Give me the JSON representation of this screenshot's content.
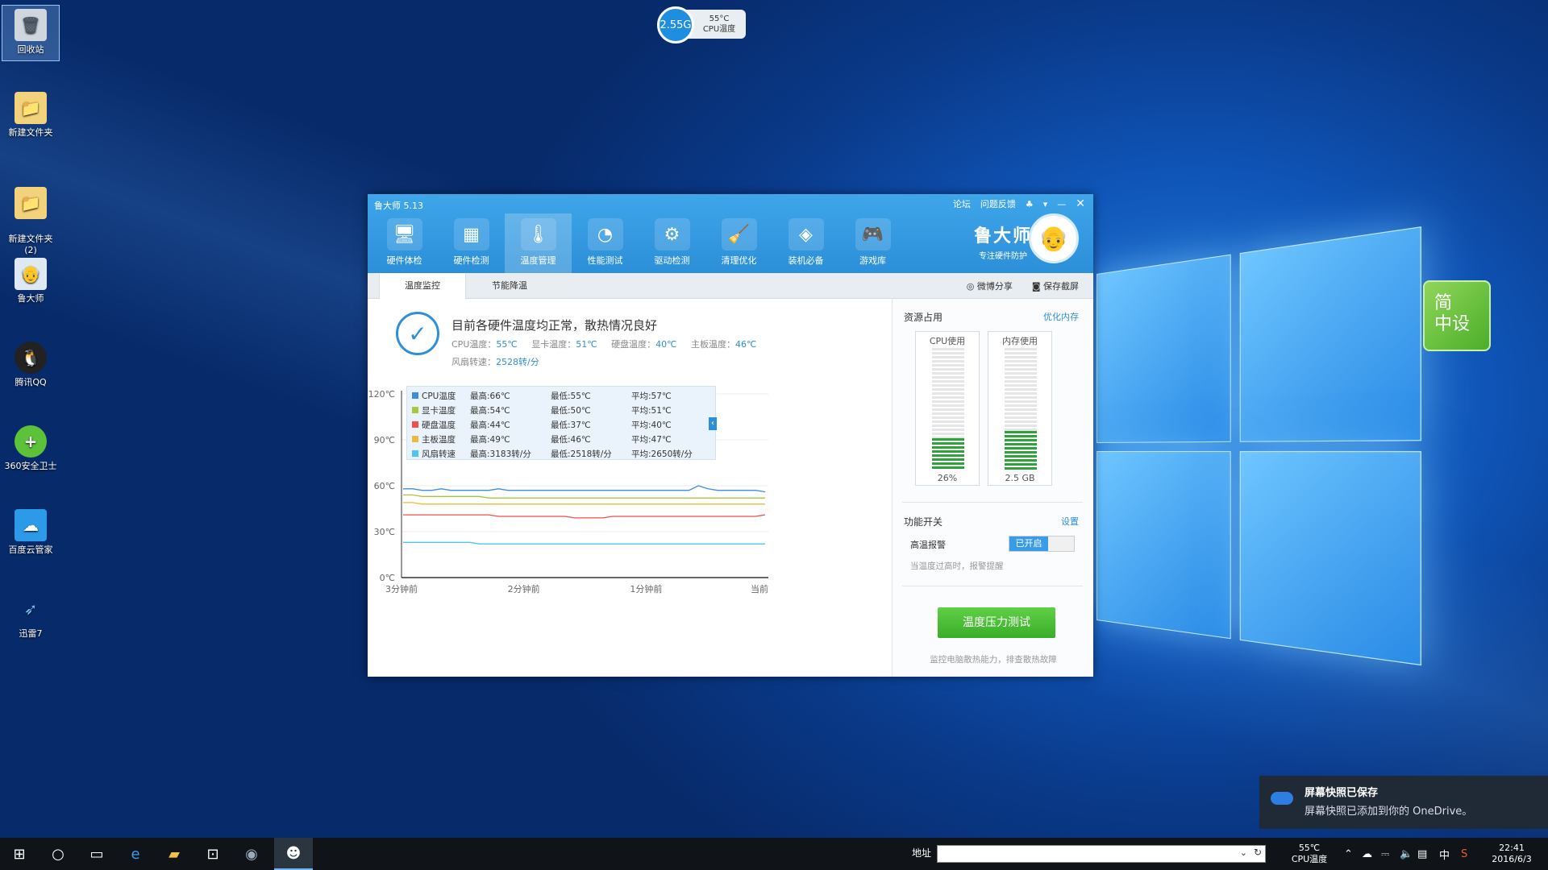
{
  "desktop": {
    "icons": [
      {
        "label": "回收站",
        "icon": "recycle-bin-icon"
      },
      {
        "label": "新建文件夹",
        "icon": "folder-icon"
      },
      {
        "label": "新建文件夹\n(2)",
        "icon": "folder-icon"
      },
      {
        "label": "鲁大师",
        "icon": "ludashi-icon"
      },
      {
        "label": "腾讯QQ",
        "icon": "qq-icon"
      },
      {
        "label": "360安全卫士",
        "icon": "360-icon"
      },
      {
        "label": "百度云管家",
        "icon": "baidu-cloud-icon"
      },
      {
        "label": "迅雷7",
        "icon": "xunlei-icon"
      }
    ]
  },
  "cpu_widget": {
    "memory": "2.55G",
    "temp": "55°C",
    "label": "CPU温度"
  },
  "green_widget": {
    "text1": "简",
    "text2": "中设"
  },
  "app": {
    "title": "鲁大师 5.13",
    "top_links": [
      "论坛",
      "问题反馈"
    ],
    "nav": [
      "硬件体检",
      "硬件检测",
      "温度管理",
      "性能测试",
      "驱动检测",
      "清理优化",
      "装机必备",
      "游戏库"
    ],
    "nav_active": 2,
    "brand": {
      "name": "鲁大师",
      "slogan": "专注硬件防护"
    },
    "tabs": [
      "温度监控",
      "节能降温"
    ],
    "tab_actions": {
      "share": "微博分享",
      "save": "保存截屏"
    },
    "status": "目前各硬件温度均正常，散热情况良好",
    "temps": {
      "cpu_label": "CPU温度：",
      "cpu": "55℃",
      "gpu_label": "显卡温度：",
      "gpu": "51℃",
      "disk_label": "硬盘温度：",
      "disk": "40℃",
      "board_label": "主板温度：",
      "board": "46℃"
    },
    "fan_label": "风扇转速：",
    "fan": "2528转/分",
    "legend": [
      {
        "name": "CPU温度",
        "max": "最高:66℃",
        "min": "最低:55℃",
        "avg": "平均:57℃",
        "color": "#3a8fe0"
      },
      {
        "name": "显卡温度",
        "max": "最高:54℃",
        "min": "最低:50℃",
        "avg": "平均:51℃",
        "color": "#a8c83a"
      },
      {
        "name": "硬盘温度",
        "max": "最高:44℃",
        "min": "最低:37℃",
        "avg": "平均:40℃",
        "color": "#f0504a"
      },
      {
        "name": "主板温度",
        "max": "最高:49℃",
        "min": "最低:46℃",
        "avg": "平均:47℃",
        "color": "#f0b83a"
      },
      {
        "name": "风扇转速",
        "max": "最高:3183转/分",
        "min": "最低:2518转/分",
        "avg": "平均:2650转/分",
        "color": "#4ac8f0"
      }
    ],
    "resources": {
      "title": "资源占用",
      "optimize": "优化内存",
      "cpu_label": "CPU使用",
      "cpu_value": "26%",
      "cpu_pct": 26,
      "mem_label": "内存使用",
      "mem_value": "2.5 GB",
      "mem_pct": 32
    },
    "functions": {
      "title": "功能开关",
      "settings": "设置",
      "alarm_label": "高温报警",
      "alarm_state": "已开启",
      "alarm_desc": "当温度过高时，报警提醒"
    },
    "stress_button": "温度压力测试",
    "stress_note": "监控电脑散热能力，排查散热故障"
  },
  "chart_data": {
    "type": "line",
    "y_ticks": [
      "120℃",
      "90℃",
      "60℃",
      "30℃",
      "0℃"
    ],
    "x_ticks": [
      "3分钟前",
      "2分钟前",
      "1分钟前",
      "当前"
    ],
    "ylim": [
      0,
      120
    ],
    "grid": true,
    "series": [
      {
        "name": "CPU温度",
        "color": "#3a8fe0",
        "values": [
          58,
          58,
          57,
          57,
          58,
          57,
          57,
          57,
          57,
          57,
          58,
          57,
          57,
          57,
          57,
          57,
          57,
          57,
          57,
          57,
          57,
          57,
          57,
          57,
          57,
          57,
          57,
          57,
          57,
          57,
          57,
          60,
          58,
          57,
          57,
          57,
          57,
          57,
          56
        ]
      },
      {
        "name": "显卡温度",
        "color": "#a8c83a",
        "values": [
          54,
          54,
          53,
          53,
          53,
          53,
          53,
          53,
          53,
          52,
          52,
          52,
          52,
          52,
          52,
          52,
          52,
          52,
          52,
          52,
          52,
          52,
          52,
          52,
          52,
          52,
          52,
          52,
          52,
          52,
          52,
          52,
          52,
          52,
          52,
          52,
          52,
          52,
          52
        ]
      },
      {
        "name": "主板温度",
        "color": "#f0b83a",
        "values": [
          49,
          49,
          48,
          48,
          48,
          48,
          48,
          48,
          48,
          48,
          48,
          48,
          48,
          48,
          48,
          48,
          48,
          48,
          48,
          48,
          48,
          48,
          48,
          48,
          48,
          48,
          48,
          48,
          48,
          48,
          48,
          48,
          48,
          48,
          48,
          48,
          48,
          48,
          48
        ]
      },
      {
        "name": "硬盘温度",
        "color": "#f0504a",
        "values": [
          41,
          41,
          41,
          41,
          41,
          41,
          41,
          41,
          41,
          41,
          40,
          40,
          40,
          40,
          40,
          40,
          40,
          40,
          39,
          39,
          39,
          39,
          40,
          40,
          40,
          40,
          40,
          40,
          40,
          40,
          40,
          40,
          40,
          40,
          40,
          40,
          40,
          40,
          41
        ]
      },
      {
        "name": "风扇转速",
        "color": "#4ac8f0",
        "values": [
          23,
          23,
          23,
          23,
          23,
          23,
          23,
          23,
          22,
          22,
          22,
          22,
          22,
          22,
          22,
          22,
          22,
          22,
          22,
          22,
          22,
          22,
          22,
          22,
          22,
          22,
          22,
          22,
          22,
          22,
          22,
          22,
          22,
          22,
          22,
          22,
          22,
          22,
          22
        ]
      }
    ]
  },
  "toast": {
    "title": "屏幕快照已保存",
    "body": "屏幕快照已添加到你的 OneDrive。"
  },
  "taskbar": {
    "address_label": "地址",
    "tray_temp": "55℃",
    "tray_temp_label": "CPU温度",
    "ime": "中",
    "time": "22:41",
    "date": "2016/6/3"
  }
}
